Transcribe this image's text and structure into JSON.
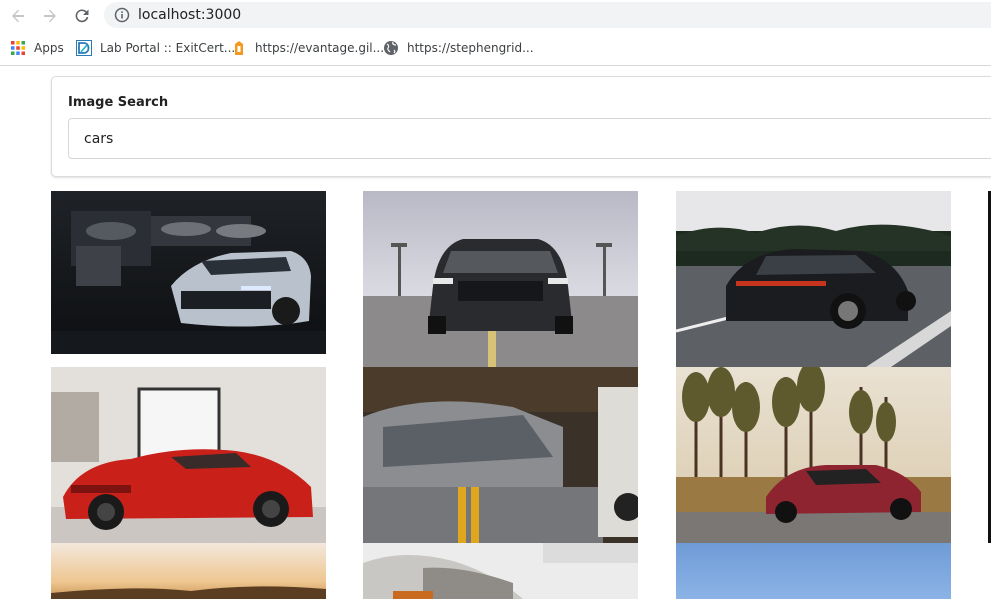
{
  "browser": {
    "url": "localhost:3000",
    "icons": {
      "back": "back-arrow-icon",
      "forward": "forward-arrow-icon",
      "reload": "reload-icon",
      "info": "info-icon"
    }
  },
  "bookmarks": [
    {
      "label": "Apps",
      "icon": "apps-grid-icon"
    },
    {
      "label": "Lab Portal :: ExitCert...",
      "icon": "lab-portal-icon"
    },
    {
      "label": "https://evantage.gil...",
      "icon": "evantage-icon"
    },
    {
      "label": "https://stephengrid...",
      "icon": "globe-icon"
    }
  ],
  "search": {
    "label": "Image Search",
    "value": "cars"
  },
  "images": [
    {
      "subject": "silver camaro in dark garage"
    },
    {
      "subject": "black mustang on road front view"
    },
    {
      "subject": "black porsche panamera driving"
    },
    {
      "subject": "red ferrari in white room"
    },
    {
      "subject": "grey car with yellow stripe"
    },
    {
      "subject": "red mercedes amg gt in forest"
    },
    {
      "subject": "sunset sky"
    },
    {
      "subject": "white cars in showroom"
    },
    {
      "subject": "blue sky"
    }
  ],
  "colors": {
    "accent": "#1a73e8",
    "omnibox": "#f1f3f4"
  }
}
